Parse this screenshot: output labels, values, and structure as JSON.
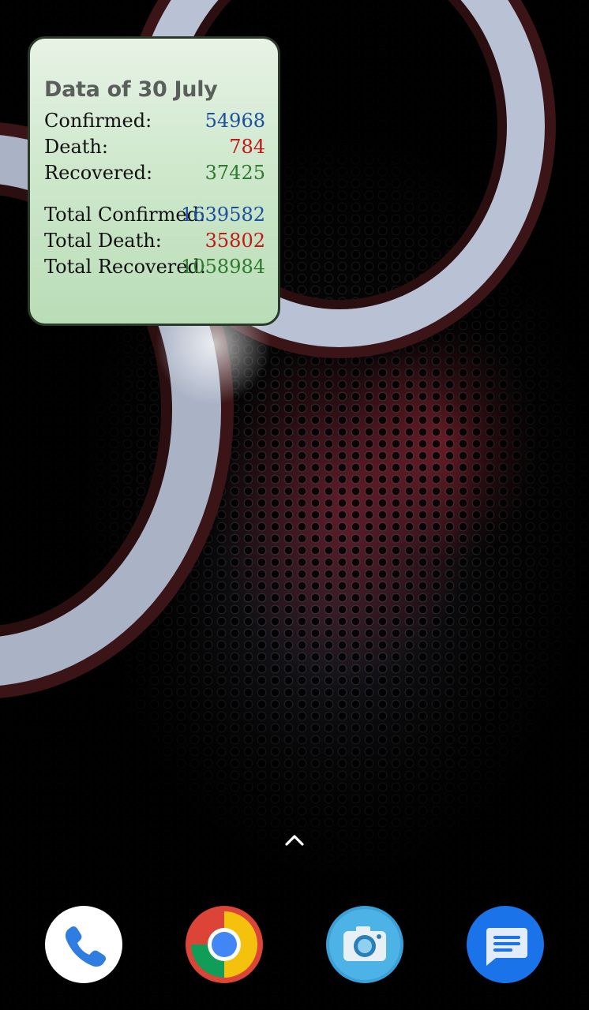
{
  "widget": {
    "title": "Data of 30 July",
    "daily": [
      {
        "label": "Confirmed:",
        "value": "54968",
        "color": "#1d4fa0"
      },
      {
        "label": "Death:",
        "value": "784",
        "color": "#c21818"
      },
      {
        "label": "Recovered:",
        "value": "37425",
        "color": "#2e7a2e"
      }
    ],
    "totals": [
      {
        "label": "Total Confirmed:",
        "value": "1639582",
        "color": "#1d4fa0"
      },
      {
        "label": "Total Death:",
        "value": "35802",
        "color": "#c21818"
      },
      {
        "label": "Total Recovered:",
        "value": "1058984",
        "color": "#2e7a2e"
      }
    ]
  },
  "launcher": {
    "swipe_icon": "chevron-up-icon",
    "dock": [
      {
        "app": "Phone",
        "icon": "phone-icon"
      },
      {
        "app": "Chrome",
        "icon": "chrome-icon"
      },
      {
        "app": "Camera",
        "icon": "camera-icon"
      },
      {
        "app": "Messages",
        "icon": "messages-icon"
      }
    ]
  }
}
